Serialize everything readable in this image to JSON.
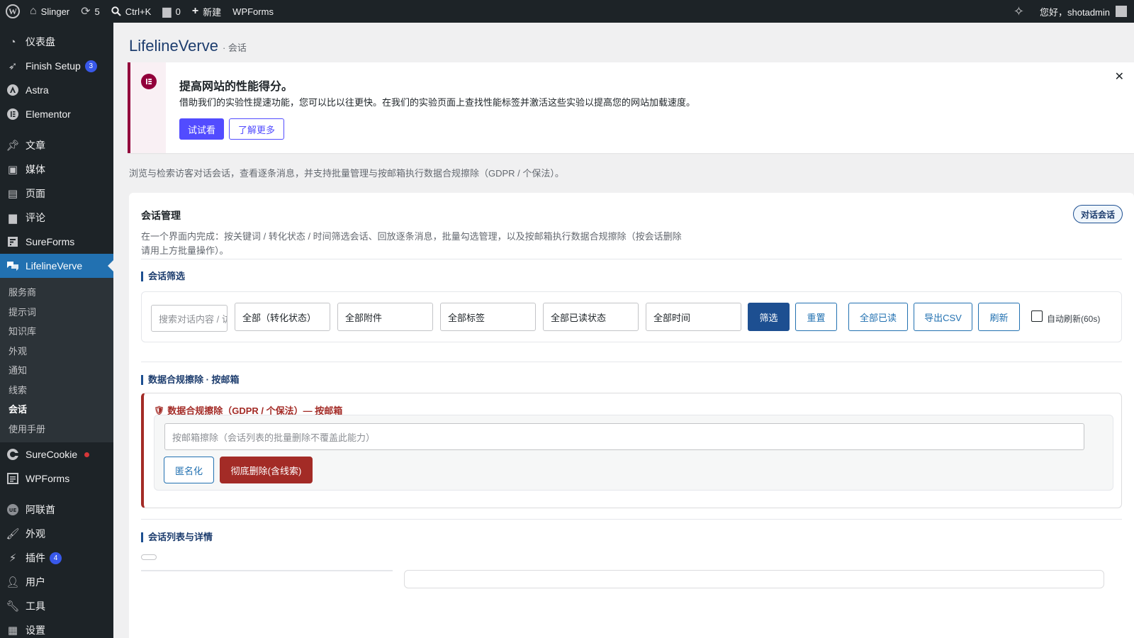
{
  "adminbar": {
    "site_name": "Slinger",
    "updates_count": "5",
    "search_shortcut": "Ctrl+K",
    "comments_count": "0",
    "new_label": "新建",
    "wpforms_label": "WPForms",
    "greeting": "您好，shotadmin"
  },
  "sidebar": {
    "items_top": [
      {
        "label": "仪表盘",
        "icon": "dashboard-icon"
      },
      {
        "label": "Finish Setup",
        "icon": "rocket-icon",
        "badge": "3"
      },
      {
        "label": "Astra",
        "icon": "astra-icon"
      },
      {
        "label": "Elementor",
        "icon": "elementor-icon"
      }
    ],
    "items_content": [
      {
        "label": "文章",
        "icon": "pin-icon"
      },
      {
        "label": "媒体",
        "icon": "media-icon"
      },
      {
        "label": "页面",
        "icon": "page-icon"
      },
      {
        "label": "评论",
        "icon": "comment-icon"
      },
      {
        "label": "SureForms",
        "icon": "sureforms-icon"
      },
      {
        "label": "LifelineVerve",
        "icon": "chat-icon"
      }
    ],
    "submenu": [
      "服务商",
      "提示词",
      "知识库",
      "外观",
      "通知",
      "线索",
      "会话",
      "使用手册"
    ],
    "submenu_current": "会话",
    "items_after": [
      {
        "label": "SureCookie",
        "icon": "surecookie-icon"
      },
      {
        "label": "WPForms",
        "icon": "wpforms-icon"
      }
    ],
    "items_bottom": [
      {
        "label": "阿联酋",
        "icon": "ue-icon"
      },
      {
        "label": "外观",
        "icon": "brush-icon"
      },
      {
        "label": "插件",
        "icon": "plugin-icon",
        "badge": "4"
      },
      {
        "label": "用户",
        "icon": "user-icon"
      },
      {
        "label": "工具",
        "icon": "wrench-icon"
      },
      {
        "label": "设置",
        "icon": "settings-icon"
      }
    ]
  },
  "page": {
    "title": "LifelineVerve",
    "subtitle": "· 会话",
    "intro": "浏览与检索访客对话会话，查看逐条消息，并支持批量管理与按邮箱执行数据合规擦除（GDPR / 个保法）。"
  },
  "notice": {
    "title": "提高网站的性能得分。",
    "text": "借助我们的实验性提速功能，您可以比以往更快。在我们的实验页面上查找性能标签并激活这些实验以提高您的网站加载速度。",
    "try_label": "试试看",
    "learn_label": "了解更多"
  },
  "card": {
    "title": "会话管理",
    "pill": "对话会话",
    "desc": "在一个界面内完成：按关键词 / 转化状态 / 时间筛选会话、回放逐条消息，批量勾选管理，以及按邮箱执行数据合规擦除（按会话删除请用上方批量操作）。"
  },
  "filter": {
    "section_title": "会话筛选",
    "search_placeholder": "搜索对话内容 / 访客",
    "conversion": "全部（转化状态）",
    "attachments": "全部附件",
    "tags": "全部标签",
    "read_state": "全部已读状态",
    "time": "全部时间",
    "filter_btn": "筛选",
    "reset_btn": "重置",
    "mark_read_btn": "全部已读",
    "export_btn": "导出CSV",
    "refresh_btn": "刷新",
    "auto_refresh": "自动刷新(60s)"
  },
  "gdpr": {
    "section_title": "数据合规擦除 · 按邮箱",
    "title": "数据合规擦除（GDPR / 个保法）— 按邮箱",
    "input_placeholder": "按邮箱擦除（会话列表的批量删除不覆盖此能力）",
    "anonymize_btn": "匿名化",
    "delete_btn": "彻底删除(含线索)"
  },
  "list": {
    "section_title": "会话列表与详情"
  },
  "colors": {
    "adminbar_bg": "#1d2327",
    "active_menu": "#2271b1",
    "primary_navy": "#1d4f91",
    "elementor": "#92003b",
    "notice_button": "#524cff",
    "danger": "#a32b26"
  }
}
